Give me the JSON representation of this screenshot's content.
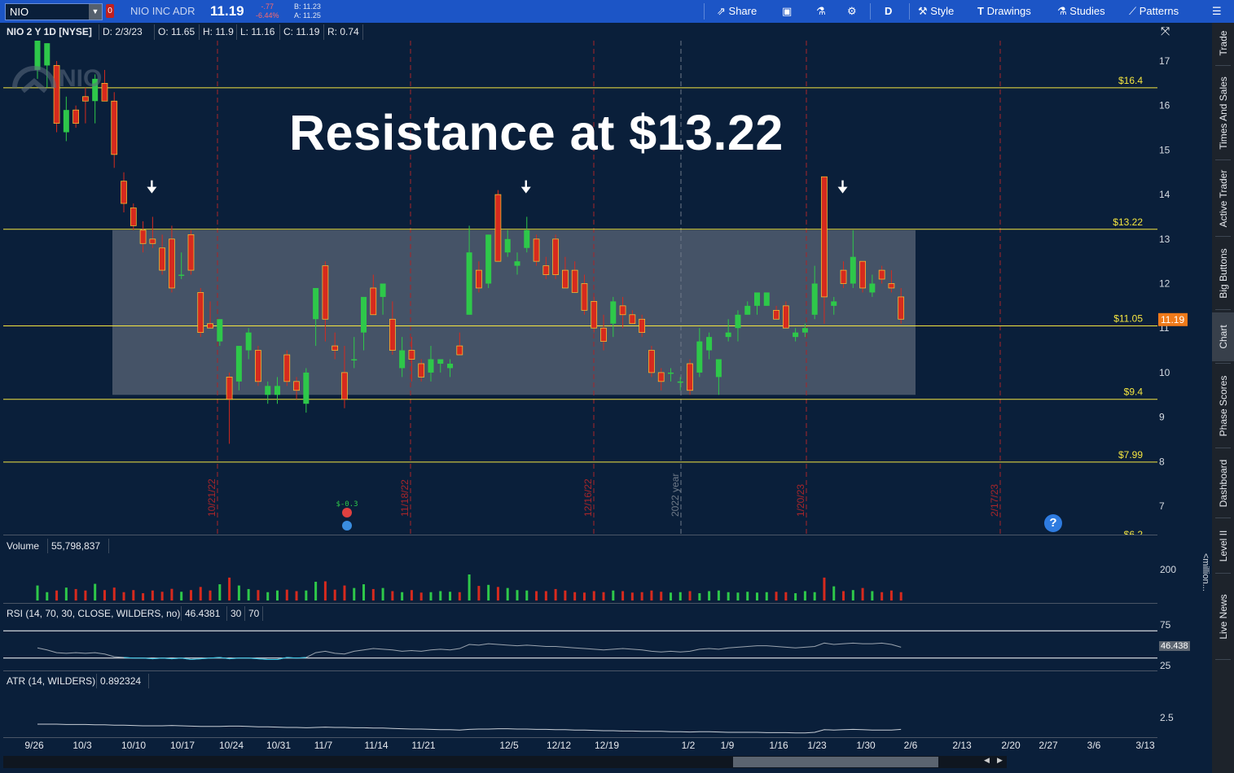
{
  "toolbar": {
    "symbol": "NIO",
    "flag": "0",
    "company": "NIO INC ADR",
    "last": "11.19",
    "net_change": "-.77",
    "net_change_pct": "-6.44%",
    "bid": "B: 11.23",
    "ask": "A: 11.25",
    "share": "Share",
    "aggregation": "D",
    "style": "Style",
    "drawings": "Drawings",
    "studies": "Studies",
    "patterns": "Patterns"
  },
  "header": {
    "title": "NIO 2 Y 1D [NYSE]",
    "date": "D: 2/3/23",
    "open": "O: 11.65",
    "high": "H: 11.9",
    "low": "L: 11.16",
    "close": "C: 11.19",
    "range": "R: 0.74"
  },
  "annotation": "Resistance at $13.22",
  "logo_text": "NIO",
  "price_levels": [
    "$16.4",
    "$13.22",
    "$11.05",
    "$9.4",
    "$7.99",
    "$6.2"
  ],
  "current_price_tag": "11.19",
  "yaxis_labels": [
    "17",
    "16",
    "15",
    "14",
    "13",
    "12",
    "11",
    "10",
    "9",
    "8",
    "7"
  ],
  "month_markers": [
    "10/21/22",
    "11/18/22",
    "12/16/22",
    "2022 year",
    "1/20/23",
    "2/17/23"
  ],
  "earnings_marker": "$-0.3",
  "volume": {
    "label": "Volume",
    "value": "55,798,837",
    "axis_top": "200",
    "units": "<million..."
  },
  "rsi": {
    "label": "RSI (14, 70, 30, CLOSE, WILDERS, no)",
    "value": "46.4381",
    "oversold": "30",
    "overbought": "70",
    "axis_top": "75",
    "axis_bottom": "25",
    "tag": "46.438"
  },
  "atr": {
    "label": "ATR (14, WILDERS)",
    "value": "0.892324",
    "axis_label": "2.5"
  },
  "xaxis": [
    "9/26",
    "10/3",
    "10/10",
    "10/17",
    "10/24",
    "10/31",
    "11/7",
    "11/14",
    "11/21",
    "12/5",
    "12/12",
    "12/19",
    "1/2",
    "1/9",
    "1/16",
    "1/23",
    "1/30",
    "2/6",
    "2/13",
    "2/20",
    "2/27",
    "3/6",
    "3/13"
  ],
  "sidebar": [
    "Trade",
    "Times And Sales",
    "Active Trader",
    "Big Buttons",
    "Chart",
    "Phase Scores",
    "Dashboard",
    "Level II",
    "Live News"
  ],
  "help": "?",
  "colors": {
    "up": "#2ec84a",
    "down": "#d62a1e",
    "level": "#f5e640",
    "background": "#0a1f3a",
    "toolbar": "#1c55c6"
  },
  "chart_data": {
    "type": "candlestick",
    "ylim": [
      6.2,
      17.6
    ],
    "candles": [
      {
        "o": 16.8,
        "h": 17.8,
        "l": 16.6,
        "c": 17.6
      },
      {
        "o": 16.9,
        "h": 17.4,
        "l": 16.4,
        "c": 17.4
      },
      {
        "o": 16.9,
        "h": 17.0,
        "l": 15.4,
        "c": 15.6
      },
      {
        "o": 15.4,
        "h": 16.2,
        "l": 15.2,
        "c": 15.9
      },
      {
        "o": 15.9,
        "h": 16.0,
        "l": 15.5,
        "c": 15.6
      },
      {
        "o": 16.2,
        "h": 16.4,
        "l": 15.6,
        "c": 16.1
      },
      {
        "o": 16.1,
        "h": 16.7,
        "l": 15.6,
        "c": 16.6
      },
      {
        "o": 16.5,
        "h": 16.8,
        "l": 16.2,
        "c": 16.1
      },
      {
        "o": 16.1,
        "h": 16.3,
        "l": 14.6,
        "c": 14.9
      },
      {
        "o": 14.3,
        "h": 14.5,
        "l": 13.6,
        "c": 13.8
      },
      {
        "o": 13.7,
        "h": 13.8,
        "l": 13.2,
        "c": 13.3
      },
      {
        "o": 13.2,
        "h": 13.4,
        "l": 12.7,
        "c": 12.9
      },
      {
        "o": 13.0,
        "h": 13.5,
        "l": 12.8,
        "c": 12.9
      },
      {
        "o": 12.8,
        "h": 13.1,
        "l": 12.2,
        "c": 12.3
      },
      {
        "o": 13.0,
        "h": 13.3,
        "l": 11.8,
        "c": 11.9
      },
      {
        "o": 12.2,
        "h": 12.7,
        "l": 12.1,
        "c": 12.2
      },
      {
        "o": 13.1,
        "h": 13.2,
        "l": 12.2,
        "c": 12.3
      },
      {
        "o": 11.8,
        "h": 11.9,
        "l": 10.8,
        "c": 10.9
      },
      {
        "o": 11.1,
        "h": 11.6,
        "l": 11.0,
        "c": 11.0
      },
      {
        "o": 10.7,
        "h": 11.2,
        "l": 10.6,
        "c": 11.2
      },
      {
        "o": 9.9,
        "h": 10.0,
        "l": 8.4,
        "c": 9.4
      },
      {
        "o": 9.8,
        "h": 10.6,
        "l": 9.6,
        "c": 10.6
      },
      {
        "o": 10.5,
        "h": 11.0,
        "l": 10.3,
        "c": 10.9
      },
      {
        "o": 10.5,
        "h": 10.6,
        "l": 9.7,
        "c": 9.8
      },
      {
        "o": 9.5,
        "h": 9.8,
        "l": 9.3,
        "c": 9.7
      },
      {
        "o": 9.5,
        "h": 9.9,
        "l": 9.3,
        "c": 9.7
      },
      {
        "o": 10.4,
        "h": 10.5,
        "l": 9.7,
        "c": 9.8
      },
      {
        "o": 9.8,
        "h": 9.9,
        "l": 9.4,
        "c": 9.6
      },
      {
        "o": 9.3,
        "h": 10.1,
        "l": 9.1,
        "c": 10.0
      },
      {
        "o": 11.2,
        "h": 11.3,
        "l": 10.6,
        "c": 11.9
      },
      {
        "o": 12.4,
        "h": 12.5,
        "l": 10.7,
        "c": 11.2
      },
      {
        "o": 10.6,
        "h": 10.9,
        "l": 10.3,
        "c": 10.5
      },
      {
        "o": 10.0,
        "h": 10.6,
        "l": 9.2,
        "c": 9.4
      },
      {
        "o": 10.3,
        "h": 10.8,
        "l": 10.1,
        "c": 10.3
      },
      {
        "o": 10.9,
        "h": 11.3,
        "l": 10.5,
        "c": 11.7
      },
      {
        "o": 11.9,
        "h": 12.2,
        "l": 11.4,
        "c": 11.3
      },
      {
        "o": 11.7,
        "h": 12.0,
        "l": 11.3,
        "c": 12.0
      },
      {
        "o": 11.2,
        "h": 11.6,
        "l": 10.4,
        "c": 10.5
      },
      {
        "o": 10.1,
        "h": 10.8,
        "l": 9.9,
        "c": 10.5
      },
      {
        "o": 10.5,
        "h": 10.8,
        "l": 9.8,
        "c": 10.3
      },
      {
        "o": 10.2,
        "h": 10.3,
        "l": 9.8,
        "c": 9.9
      },
      {
        "o": 10.0,
        "h": 10.6,
        "l": 9.8,
        "c": 10.3
      },
      {
        "o": 10.2,
        "h": 10.2,
        "l": 10.0,
        "c": 10.3
      },
      {
        "o": 10.1,
        "h": 10.3,
        "l": 9.9,
        "c": 10.2
      },
      {
        "o": 10.6,
        "h": 10.9,
        "l": 10.4,
        "c": 10.4
      },
      {
        "o": 11.3,
        "h": 13.3,
        "l": 11.3,
        "c": 12.7
      },
      {
        "o": 12.3,
        "h": 12.5,
        "l": 11.8,
        "c": 11.9
      },
      {
        "o": 12.0,
        "h": 13.1,
        "l": 11.9,
        "c": 13.1
      },
      {
        "o": 14.0,
        "h": 14.1,
        "l": 12.5,
        "c": 12.5
      },
      {
        "o": 12.7,
        "h": 13.2,
        "l": 12.6,
        "c": 13.0
      },
      {
        "o": 12.4,
        "h": 12.7,
        "l": 12.2,
        "c": 12.5
      },
      {
        "o": 12.8,
        "h": 13.5,
        "l": 12.7,
        "c": 13.2
      },
      {
        "o": 13.0,
        "h": 13.1,
        "l": 12.4,
        "c": 12.5
      },
      {
        "o": 12.4,
        "h": 12.6,
        "l": 12.1,
        "c": 12.2
      },
      {
        "o": 13.0,
        "h": 13.1,
        "l": 12.1,
        "c": 12.2
      },
      {
        "o": 12.3,
        "h": 12.6,
        "l": 12.0,
        "c": 11.9
      },
      {
        "o": 12.3,
        "h": 12.5,
        "l": 11.8,
        "c": 11.8
      },
      {
        "o": 12.0,
        "h": 12.2,
        "l": 11.3,
        "c": 11.4
      },
      {
        "o": 11.6,
        "h": 11.7,
        "l": 10.9,
        "c": 11.0
      },
      {
        "o": 11.0,
        "h": 11.3,
        "l": 10.5,
        "c": 10.7
      },
      {
        "o": 11.1,
        "h": 11.7,
        "l": 10.8,
        "c": 11.6
      },
      {
        "o": 11.5,
        "h": 11.7,
        "l": 11.0,
        "c": 11.3
      },
      {
        "o": 11.3,
        "h": 11.4,
        "l": 11.2,
        "c": 11.1
      },
      {
        "o": 11.2,
        "h": 11.3,
        "l": 10.8,
        "c": 10.9
      },
      {
        "o": 10.5,
        "h": 10.6,
        "l": 9.9,
        "c": 10.0
      },
      {
        "o": 10.0,
        "h": 10.1,
        "l": 9.6,
        "c": 9.8
      },
      {
        "o": 10.0,
        "h": 10.1,
        "l": 9.8,
        "c": 10.0
      },
      {
        "o": 9.8,
        "h": 9.9,
        "l": 9.6,
        "c": 9.8
      },
      {
        "o": 10.2,
        "h": 10.3,
        "l": 9.5,
        "c": 9.6
      },
      {
        "o": 10.0,
        "h": 11.0,
        "l": 9.9,
        "c": 10.7
      },
      {
        "o": 10.5,
        "h": 10.9,
        "l": 10.3,
        "c": 10.8
      },
      {
        "o": 9.9,
        "h": 10.2,
        "l": 9.5,
        "c": 10.3
      },
      {
        "o": 10.8,
        "h": 11.2,
        "l": 10.7,
        "c": 10.9
      },
      {
        "o": 11.0,
        "h": 11.4,
        "l": 10.7,
        "c": 11.3
      },
      {
        "o": 11.3,
        "h": 11.6,
        "l": 11.3,
        "c": 11.5
      },
      {
        "o": 11.5,
        "h": 11.8,
        "l": 11.3,
        "c": 11.8
      },
      {
        "o": 11.5,
        "h": 11.8,
        "l": 11.5,
        "c": 11.8
      },
      {
        "o": 11.4,
        "h": 11.5,
        "l": 11.2,
        "c": 11.2
      },
      {
        "o": 11.5,
        "h": 11.6,
        "l": 11.0,
        "c": 11.0
      },
      {
        "o": 10.8,
        "h": 11.0,
        "l": 10.7,
        "c": 10.9
      },
      {
        "o": 10.9,
        "h": 11.1,
        "l": 10.8,
        "c": 11.0
      },
      {
        "o": 11.3,
        "h": 12.4,
        "l": 11.2,
        "c": 12.0
      },
      {
        "o": 14.4,
        "h": 14.4,
        "l": 11.1,
        "c": 11.7
      },
      {
        "o": 11.5,
        "h": 11.7,
        "l": 11.3,
        "c": 11.6
      },
      {
        "o": 12.3,
        "h": 12.5,
        "l": 11.9,
        "c": 12.0
      },
      {
        "o": 12.0,
        "h": 13.2,
        "l": 11.9,
        "c": 12.6
      },
      {
        "o": 12.5,
        "h": 12.5,
        "l": 11.8,
        "c": 11.9
      },
      {
        "o": 11.8,
        "h": 12.2,
        "l": 11.7,
        "c": 12.0
      },
      {
        "o": 12.3,
        "h": 12.4,
        "l": 12.0,
        "c": 12.1
      },
      {
        "o": 12.0,
        "h": 12.3,
        "l": 11.8,
        "c": 11.9
      },
      {
        "o": 11.7,
        "h": 11.9,
        "l": 11.1,
        "c": 11.2
      }
    ],
    "levels": [
      16.4,
      13.22,
      11.05,
      9.4,
      7.99,
      6.2
    ],
    "range_box": {
      "low": 9.5,
      "high": 13.2
    },
    "resistance_arrows": [
      12,
      51,
      84
    ],
    "volume": [
      72,
      40,
      48,
      62,
      55,
      48,
      80,
      50,
      62,
      40,
      50,
      35,
      48,
      42,
      56,
      42,
      50,
      65,
      48,
      78,
      110,
      72,
      55,
      50,
      40,
      48,
      52,
      45,
      48,
      90,
      92,
      52,
      72,
      60,
      78,
      55,
      60,
      45,
      40,
      50,
      38,
      40,
      45,
      42,
      40,
      125,
      70,
      75,
      65,
      60,
      50,
      48,
      45,
      45,
      55,
      48,
      40,
      38,
      45,
      40,
      48,
      45,
      38,
      40,
      48,
      42,
      38,
      40,
      45,
      35,
      45,
      48,
      40,
      38,
      42,
      38,
      40,
      42,
      40,
      35,
      45,
      40,
      110,
      68,
      45,
      50,
      60,
      45,
      40,
      48,
      40
    ],
    "rsi": [
      45,
      42,
      38,
      37,
      38,
      37,
      38,
      36,
      32,
      31,
      30,
      30,
      29,
      30,
      29,
      30,
      28,
      29,
      30,
      31,
      29,
      30,
      30,
      29,
      28,
      28,
      31,
      30,
      31,
      38,
      40,
      37,
      36,
      40,
      42,
      44,
      43,
      42,
      40,
      41,
      40,
      42,
      43,
      42,
      44,
      50,
      49,
      51,
      50,
      49,
      48,
      49,
      48,
      47,
      47,
      46,
      45,
      44,
      43,
      42,
      43,
      44,
      43,
      42,
      40,
      39,
      40,
      39,
      40,
      43,
      44,
      43,
      45,
      46,
      47,
      48,
      48,
      47,
      46,
      45,
      46,
      47,
      52,
      50,
      51,
      52,
      51,
      51,
      52,
      50,
      46
    ],
    "atr": [
      1.05,
      1.05,
      1.05,
      1.04,
      1.04,
      1.04,
      1.03,
      1.03,
      1.02,
      1.02,
      1.01,
      1.0,
      1.0,
      1.0,
      1.01,
      1.0,
      0.99,
      0.98,
      0.98,
      0.98,
      0.99,
      0.99,
      0.98,
      0.97,
      0.97,
      0.96,
      0.95,
      0.95,
      0.94,
      0.95,
      0.96,
      0.95,
      0.95,
      0.94,
      0.94,
      0.93,
      0.93,
      0.92,
      0.91,
      0.9,
      0.9,
      0.89,
      0.88,
      0.88,
      0.87,
      0.89,
      0.9,
      0.9,
      0.91,
      0.91,
      0.9,
      0.9,
      0.89,
      0.89,
      0.88,
      0.88,
      0.87,
      0.87,
      0.86,
      0.85,
      0.85,
      0.84,
      0.84,
      0.83,
      0.83,
      0.83,
      0.82,
      0.82,
      0.81,
      0.82,
      0.82,
      0.81,
      0.8,
      0.8,
      0.8,
      0.8,
      0.79,
      0.79,
      0.79,
      0.78,
      0.78,
      0.8,
      0.88,
      0.87,
      0.88,
      0.89,
      0.88,
      0.87,
      0.87,
      0.87,
      0.89
    ]
  }
}
